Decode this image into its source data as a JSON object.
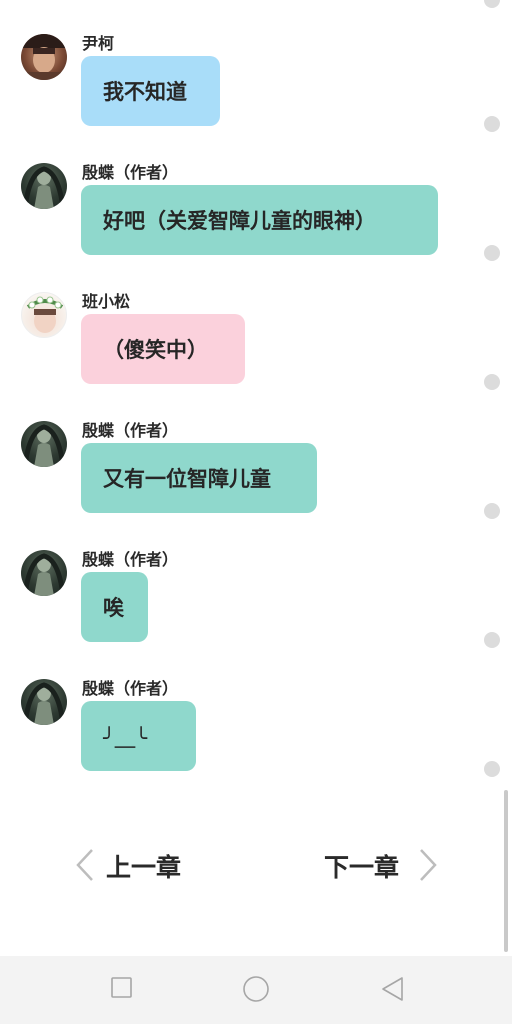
{
  "messages": [
    {
      "sender": "尹柯",
      "text": "我不知道",
      "bubble_color": "#a9ddf9",
      "avatar": "avatar-yin-ke"
    },
    {
      "sender": "殷蝶（作者）",
      "text": "好吧（关爱智障儿童的眼神）",
      "bubble_color": "#8fd8cc",
      "avatar": "avatar-author"
    },
    {
      "sender": "班小松",
      "text": "（傻笑中）",
      "bubble_color": "#fbd1dc",
      "avatar": "avatar-ban-xiaosong"
    },
    {
      "sender": "殷蝶（作者）",
      "text": "又有一位智障儿童",
      "bubble_color": "#8fd8cc",
      "avatar": "avatar-author"
    },
    {
      "sender": "殷蝶（作者）",
      "text": "唉",
      "bubble_color": "#8fd8cc",
      "avatar": "avatar-author"
    },
    {
      "sender": "殷蝶（作者）",
      "text": "╯＿╰",
      "bubble_color": "#8fd8cc",
      "avatar": "avatar-author"
    }
  ],
  "chapter_nav": {
    "prev_label": "上一章",
    "next_label": "下一章"
  },
  "system_nav": {
    "icons": [
      "square-icon",
      "circle-icon",
      "back-triangle-icon"
    ]
  },
  "colors": {
    "blue_bubble": "#a9ddf9",
    "teal_bubble": "#8fd8cc",
    "pink_bubble": "#fbd1dc",
    "dot": "#dcdcdc"
  }
}
